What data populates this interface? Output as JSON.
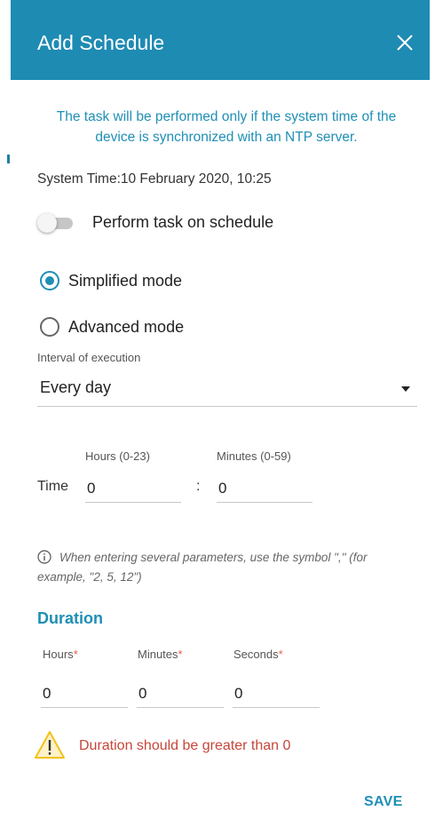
{
  "dialog": {
    "title": "Add Schedule",
    "notice": "The task will be performed only if the system time of the device is synchronized with an NTP server.",
    "system_time": "System Time:10 February 2020, 10:25"
  },
  "schedule_toggle": {
    "label": "Perform task on schedule",
    "on": false
  },
  "modes": {
    "simplified_label": "Simplified mode",
    "advanced_label": "Advanced mode",
    "selected": "simplified"
  },
  "interval": {
    "caption": "Interval of execution",
    "value": "Every day"
  },
  "time": {
    "label": "Time",
    "hours_caption": "Hours (0-23)",
    "minutes_caption": "Minutes (0-59)",
    "hours_value": "0",
    "separator": ":",
    "minutes_value": "0"
  },
  "hint": "When entering several parameters, use the symbol \",\" (for example, \"2, 5, 12\")",
  "duration": {
    "title": "Duration",
    "hours_caption": "Hours",
    "minutes_caption": "Minutes",
    "seconds_caption": "Seconds",
    "required_mark": "*",
    "hours_value": "0",
    "minutes_value": "0",
    "seconds_value": "0"
  },
  "warning": "Duration should be greater than 0",
  "actions": {
    "save_label": "SAVE"
  },
  "colors": {
    "header": "#1e8bb3",
    "accent": "#1f8fb5",
    "error": "#c5463a",
    "warning_icon": "#f3c11a"
  },
  "icons": {
    "close": "close-icon",
    "info": "info-icon",
    "warning": "warning-icon",
    "dropdown": "caret-down-icon"
  }
}
